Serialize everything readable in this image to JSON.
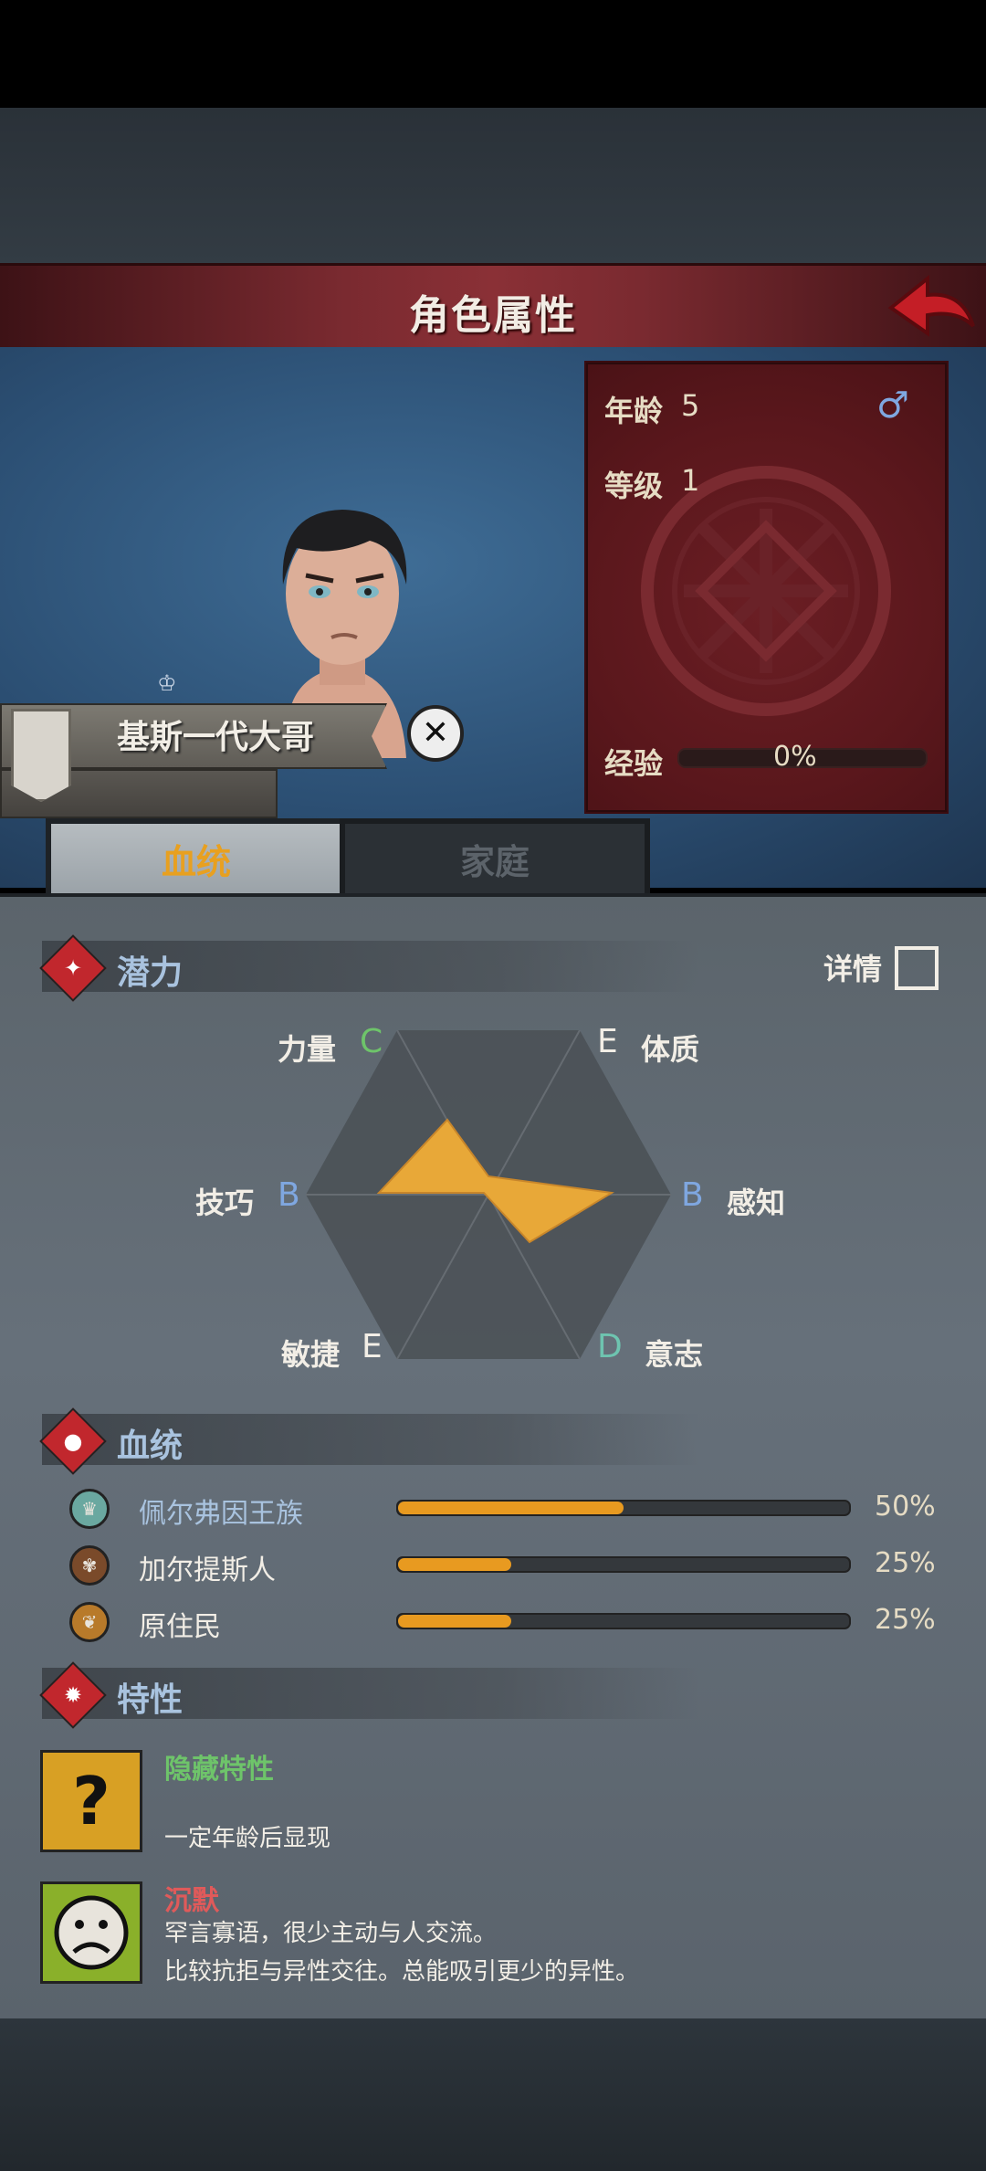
{
  "header": {
    "title": "角色属性"
  },
  "stats": {
    "age_label": "年龄",
    "age_value": "5",
    "level_label": "等级",
    "level_value": "1",
    "exp_label": "经验",
    "exp_value": "0%",
    "exp_fraction": 0,
    "gender_icon": "male-icon"
  },
  "character": {
    "name": "基斯一代大哥"
  },
  "tabs": [
    {
      "label": "血统",
      "active": true
    },
    {
      "label": "家庭",
      "active": false
    }
  ],
  "potential": {
    "title": "潜力",
    "detail_label": "详情",
    "attributes": [
      {
        "name": "力量",
        "grade": "C"
      },
      {
        "name": "体质",
        "grade": "E"
      },
      {
        "name": "感知",
        "grade": "B"
      },
      {
        "name": "意志",
        "grade": "D"
      },
      {
        "name": "敏捷",
        "grade": "E"
      },
      {
        "name": "技巧",
        "grade": "B"
      }
    ]
  },
  "lineage": {
    "title": "血统",
    "items": [
      {
        "name": "佩尔弗因王族",
        "percent": "50%",
        "value": 0.5,
        "color": "#a9c3df"
      },
      {
        "name": "加尔提斯人",
        "percent": "25%",
        "value": 0.25,
        "color": "#f2eee6"
      },
      {
        "name": "原住民",
        "percent": "25%",
        "value": 0.25,
        "color": "#f2eee6"
      }
    ]
  },
  "traits": {
    "title": "特性",
    "items": [
      {
        "name": "隐藏特性",
        "color": "#6ec46a",
        "desc": "一定年龄后显现"
      },
      {
        "name": "沉默",
        "color": "#e05a5a",
        "desc1": "罕言寡语，很少主动与人交流。",
        "desc2": "比较抗拒与异性交往。总能吸引更少的异性。"
      }
    ]
  }
}
